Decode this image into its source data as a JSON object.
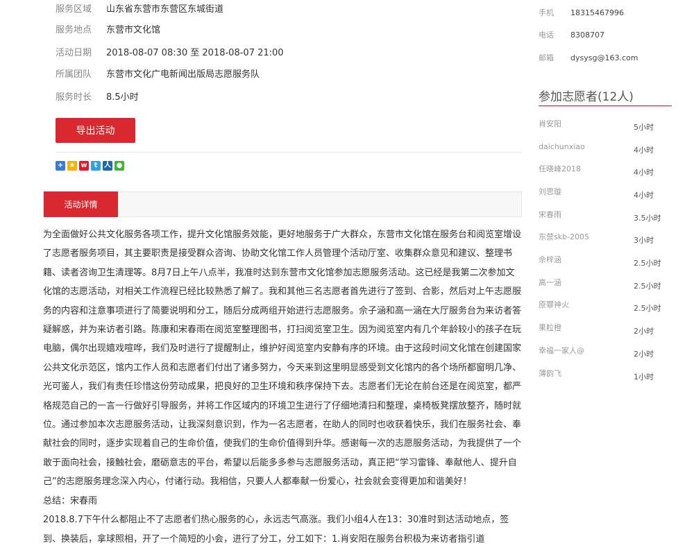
{
  "info": [
    {
      "key": "服务区域",
      "value": "山东省东营市东营区东城街道"
    },
    {
      "key": "服务地点",
      "value": "东营市文化馆"
    },
    {
      "key": "活动日期",
      "value": "2018-08-07 08:30 至 2018-08-07 21:00"
    },
    {
      "key": "所属团队",
      "value": "东营市文化广电新闻出版局志愿服务队"
    },
    {
      "key": "服务时长",
      "value": "8.5小时"
    }
  ],
  "export_label": "导出活动",
  "share_icons": [
    "more-share-icon",
    "qzone-icon",
    "weibo-icon",
    "tencent-weibo-icon",
    "renren-icon",
    "wechat-icon"
  ],
  "tab_label": "活动详情",
  "detail": {
    "p1": "为全面做好公共文化服务各项工作，提升文化馆服务效能，更好地服务于广大群众，东营市文化馆在服务台和阅览室增设了志愿者服务项目，其主要职责是接受群众咨询、协助文化馆工作人员管理个活动厅室、收集群众意见和建议、整理书籍、读者咨询卫生清理等。8月7日上午八点半，我准时达到东营市文化馆参加志愿服务活动。这已经是我第二次参加文化馆的志愿活动，对相关工作流程已经比较熟悉了解了。我和其他三名志愿者首先进行了签到、合影，然后对上午志愿服务的内容和注意事项进行了简要说明和分工，随后分成两组开始进行志愿服务。佘子涵和高一涵在大厅服务台为来访者答疑解惑，并为来访者引路。陈康和宋春雨在阅览室整理图书，打扫阅览室卫生。因为阅览室内有几个年龄较小的孩子在玩电脑，偶尔出现嬉戏喧哗，我们及时进行了提醒制止，维护好阅览室内安静有序的环境。由于这段时间文化馆在创建国家公共文化示范区，馆内工作人员和志愿者们付出了诸多努力，今天来到这里明显感受到文化馆内的各个场所都窗明几净、光可鉴人，我们有责任珍惜这份劳动成果，把良好的卫生环境和秩序保持下去。志愿者们无论在前台还是在阅览室，都严格规范自己的一言一行做好引导服务，并将工作区域内的环境卫生进行了仔细地清扫和整理，桌椅板凳摆放整齐，随时就位。通过参加本次志愿服务活动，让我深刻意识到，作为一名志愿者，在助人的同时也收获着快乐，我们在服务社会、奉献社会的同时，逐步实现着自己的生命价值，使我们的生命价值得到升华。感谢每一次的志愿服务活动，为我提供了一个敢于面向社会，接触社会，磨砺意志的平台，希望以后能多多参与志愿服务活动，真正把“学习雷锋、奉献他人、提升自己”的志愿服务理念深入内心，付诸行动。我相信，只要人人都奉献一份爱心，社会就会变得更加和谐美好！",
    "p2": "总结：宋春雨",
    "p3": "2018.8.7下午什么都阻止不了志愿者们热心服务的心，永远志气高涨。我们小组4人在13：30准时到达活动地点，签到、换装后，拿球照相，开了一个简短的小会，进行了分工，分工如下：1.肖安阳在服务台积极为来访者指引道"
  },
  "contact": [
    {
      "key": "手机",
      "value": "18315467996"
    },
    {
      "key": "电话",
      "value": "8308707"
    },
    {
      "key": "邮箱",
      "value": "dysysg@163.com"
    }
  ],
  "volunteers_title": "参加志愿者(12人)",
  "volunteers": [
    {
      "name": "肖安阳",
      "hours": "5小时"
    },
    {
      "name": "daichunxiao",
      "hours": "4小时"
    },
    {
      "name": "任晓峰2018",
      "hours": "4小时"
    },
    {
      "name": "刘思璇",
      "hours": "4小时"
    },
    {
      "name": "宋春雨",
      "hours": "3.5小时"
    },
    {
      "name": "东营skb-2005",
      "hours": "3小时"
    },
    {
      "name": "佘梓涵",
      "hours": "2.5小时"
    },
    {
      "name": "高一涵",
      "hours": "2.5小时"
    },
    {
      "name": "原罪神火",
      "hours": "2.5小时"
    },
    {
      "name": "果粒橙",
      "hours": "2小时"
    },
    {
      "name": "幸福一家人@",
      "hours": "2小时"
    },
    {
      "name": "薄韵飞",
      "hours": "1小时"
    }
  ],
  "colors": {
    "accent": "#d9282f"
  }
}
